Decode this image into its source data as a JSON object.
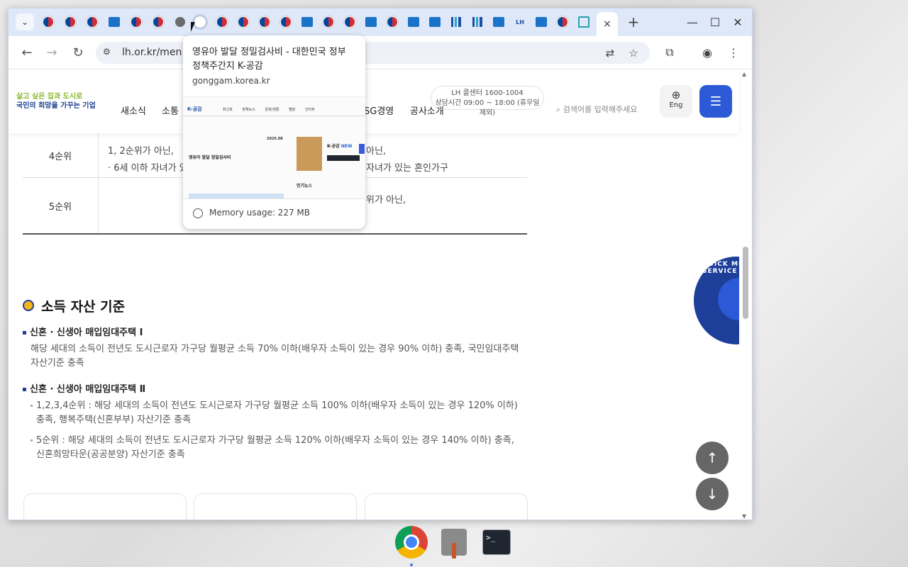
{
  "browser": {
    "active_tab_close": "×",
    "new_tab": "+",
    "tab_search_glyph": "⌄",
    "back": "←",
    "forward": "→",
    "reload": "↻",
    "url": "lh.or.kr/men",
    "window_controls": {
      "minimize": "—",
      "maximize": "☐",
      "close": "✕"
    }
  },
  "tooltip": {
    "title": "영유아 발달 정밀검사비 - 대한민국 정부 정책주간지 K-공감",
    "domain": "gonggam.korea.kr",
    "memory": "Memory usage: 227 MB",
    "thumb": {
      "logo": "K-공감",
      "nav": [
        "최신호",
        "정책뉴스",
        "문화/생활",
        "별분",
        "인터뷰"
      ],
      "date": "2025.08",
      "heading": "영유아 발달 정밀검사비",
      "brand": "K-공감",
      "brand_new": "NEW",
      "popular": "인기뉴스"
    }
  },
  "site": {
    "logo_line1": "살고 싶은 집과 도시로",
    "logo_line2": "국민의 희망을 가꾸는 기업",
    "nav": [
      "새소식",
      "소통",
      "SG경영",
      "공사소개"
    ],
    "callcenter_line1": "LH 콜센터 1600-1004",
    "callcenter_line2": "상담시간 09:00 ~ 18:00 (휴무일 제외)",
    "search_placeholder": "검색어를 입력해주세요",
    "eng": "Eng",
    "menu_icon": "☰"
  },
  "table": {
    "rows": [
      {
        "rank": "4순위",
        "line1": "1, 2순위가 아닌,",
        "line1_right": "아닌,",
        "line2": "6세 이하 자녀가 있",
        "line2_right": "자녀가 있는 혼인가구"
      },
      {
        "rank": "5순위",
        "line1": "",
        "line1_right": "위가 아닌,",
        "line2": "",
        "line2_right": ""
      }
    ]
  },
  "section": {
    "title": "소득 자산 기준",
    "item1_title": "신혼 · 신생아 매입임대주택 Ⅰ",
    "item1_text": "해당 세대의 소득이 전년도 도시근로자 가구당 월평균 소득 70% 이하(배우자 소득이 있는 경우 90% 이하) 충족, 국민임대주택 자산기준 충족",
    "item2_title": "신혼 · 신생아 매입임대주택 Ⅱ",
    "item2_bullets": [
      "1,2,3,4순위 : 해당 세대의 소득이 전년도 도시근로자 가구당 월평균 소득 100% 이하(배우자 소득이 있는 경우 120% 이하) 충족, 행복주택(신혼부부) 자산기준 충족",
      "5순위 : 해당 세대의 소득이 전년도 도시근로자 가구당 월평균 소득 120% 이하(배우자 소득이 있는 경우 140% 이하) 충족, 신혼희망타운(공공분양) 자산기준 충족"
    ]
  },
  "quick_menu": {
    "label": "QUICK MENU SERVICE"
  },
  "fab": {
    "up": "↑",
    "down": "↓"
  },
  "dock": {
    "terminal": ">_"
  },
  "colors": {
    "brand_blue": "#1d3f9a",
    "accent_blue": "#2c5ad6",
    "logo_green": "#8ab92d"
  }
}
